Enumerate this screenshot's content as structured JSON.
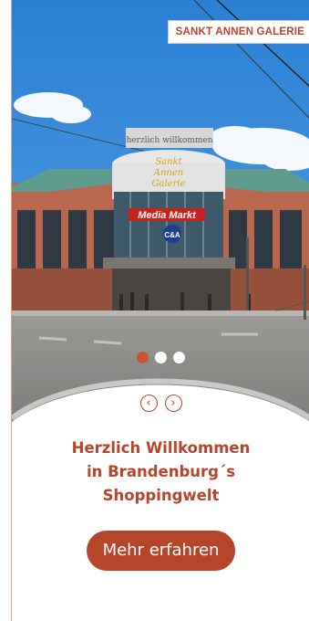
{
  "hero": {
    "badge_text": "SANKT ANNEN GALERIE",
    "sign_text": "Media Markt",
    "top_sign_text": "herzlich willkommen",
    "store_logo_text": "C&A",
    "slides_total": 3,
    "active_slide": 1
  },
  "nav": {
    "prev_icon": "chevron-left-icon",
    "next_icon": "chevron-right-icon",
    "prev_glyph": "‹",
    "next_glyph": "›"
  },
  "welcome": {
    "line1": "Herzlich Willkommen",
    "line2": "in Brandenburg´s",
    "line3": "Shoppingwelt"
  },
  "cta": {
    "label": "Mehr erfahren"
  },
  "colors": {
    "accent": "#b6452c",
    "dot_active": "#c9532f",
    "sky": "#2f86d6"
  }
}
